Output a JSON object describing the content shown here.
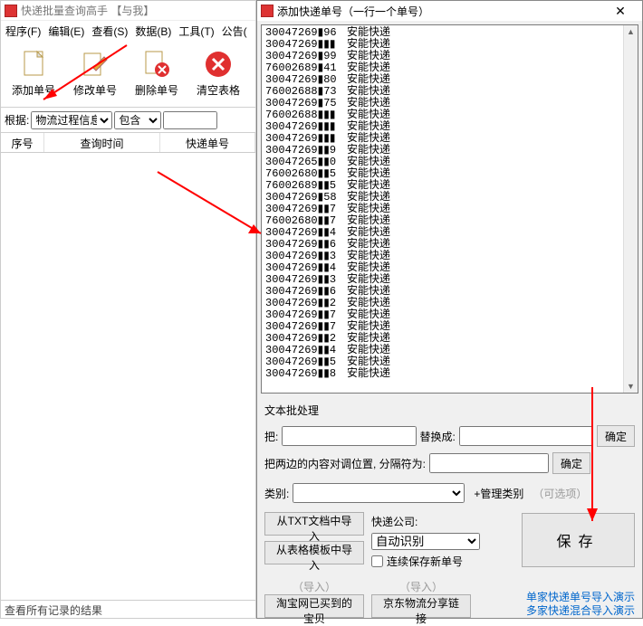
{
  "main": {
    "title": "快递批量查询高手 【与我】",
    "menu": [
      "程序(F)",
      "编辑(E)",
      "查看(S)",
      "数据(B)",
      "工具(T)",
      "公告("
    ],
    "toolbar": [
      {
        "name": "add-no-button",
        "label": "添加单号"
      },
      {
        "name": "edit-no-button",
        "label": "修改单号"
      },
      {
        "name": "del-no-button",
        "label": "删除单号"
      },
      {
        "name": "clear-table-button",
        "label": "清空表格"
      }
    ],
    "filter": {
      "label": "根据:",
      "field1": "物流过程信息",
      "field2": "包含",
      "value": ""
    },
    "columns": {
      "seq": "序号",
      "qtime": "查询时间",
      "tno": "快递单号"
    },
    "status": "查看所有记录的结果"
  },
  "dialog": {
    "title": "添加快递单号（一行一个单号）",
    "list": [
      {
        "num": "30047269▮96",
        "label": "安能快递"
      },
      {
        "num": "30047269▮▮▮",
        "label": "安能快递"
      },
      {
        "num": "30047269▮99",
        "label": "安能快递"
      },
      {
        "num": "76002689▮41",
        "label": "安能快递"
      },
      {
        "num": "30047269▮80",
        "label": "安能快递"
      },
      {
        "num": "76002688▮73",
        "label": "安能快递"
      },
      {
        "num": "30047269▮75",
        "label": "安能快递"
      },
      {
        "num": "76002688▮▮▮",
        "label": "安能快递"
      },
      {
        "num": "30047269▮▮▮",
        "label": "安能快递"
      },
      {
        "num": "30047269▮▮▮",
        "label": "安能快递"
      },
      {
        "num": "30047269▮▮9",
        "label": "安能快递"
      },
      {
        "num": "30047265▮▮0",
        "label": "安能快递"
      },
      {
        "num": "76002680▮▮5",
        "label": "安能快递"
      },
      {
        "num": "76002689▮▮5",
        "label": "安能快递"
      },
      {
        "num": "30047269▮58",
        "label": "安能快递"
      },
      {
        "num": "30047269▮▮7",
        "label": "安能快递"
      },
      {
        "num": "76002680▮▮7",
        "label": "安能快递"
      },
      {
        "num": "30047269▮▮4",
        "label": "安能快递"
      },
      {
        "num": "30047269▮▮6",
        "label": "安能快递"
      },
      {
        "num": "30047269▮▮3",
        "label": "安能快递"
      },
      {
        "num": "30047269▮▮4",
        "label": "安能快递"
      },
      {
        "num": "30047269▮▮3",
        "label": "安能快递"
      },
      {
        "num": "30047269▮▮6",
        "label": "安能快递"
      },
      {
        "num": "30047269▮▮2",
        "label": "安能快递"
      },
      {
        "num": "30047269▮▮7",
        "label": "安能快递"
      },
      {
        "num": "30047269▮▮7",
        "label": "安能快递"
      },
      {
        "num": "30047269▮▮2",
        "label": "安能快递"
      },
      {
        "num": "30047269▮▮4",
        "label": "安能快递"
      },
      {
        "num": "30047269▮▮5",
        "label": "安能快递"
      },
      {
        "num": "30047269▮▮8",
        "label": "安能快递"
      }
    ],
    "batch_label": "文本批处理",
    "replace_from_label": "把:",
    "replace_to_label": "替换成:",
    "ok_btn": "确定",
    "swap_label": "把两边的内容对调位置, 分隔符为:",
    "category_label": "类别:",
    "manage_category": "+管理类别",
    "optional": "（可选项）",
    "import_txt": "从TXT文档中导入",
    "import_template": "从表格模板中导入",
    "company_label": "快递公司:",
    "company_value": "自动识别",
    "cont_save": "连续保存新单号",
    "save_btn": "保存",
    "import_hint": "（导入）",
    "taobao_btn": "淘宝网已买到的宝贝",
    "jd_btn": "京东物流分享链接",
    "link1": "单家快递单号导入演示",
    "link2": "多家快递混合导入演示"
  }
}
